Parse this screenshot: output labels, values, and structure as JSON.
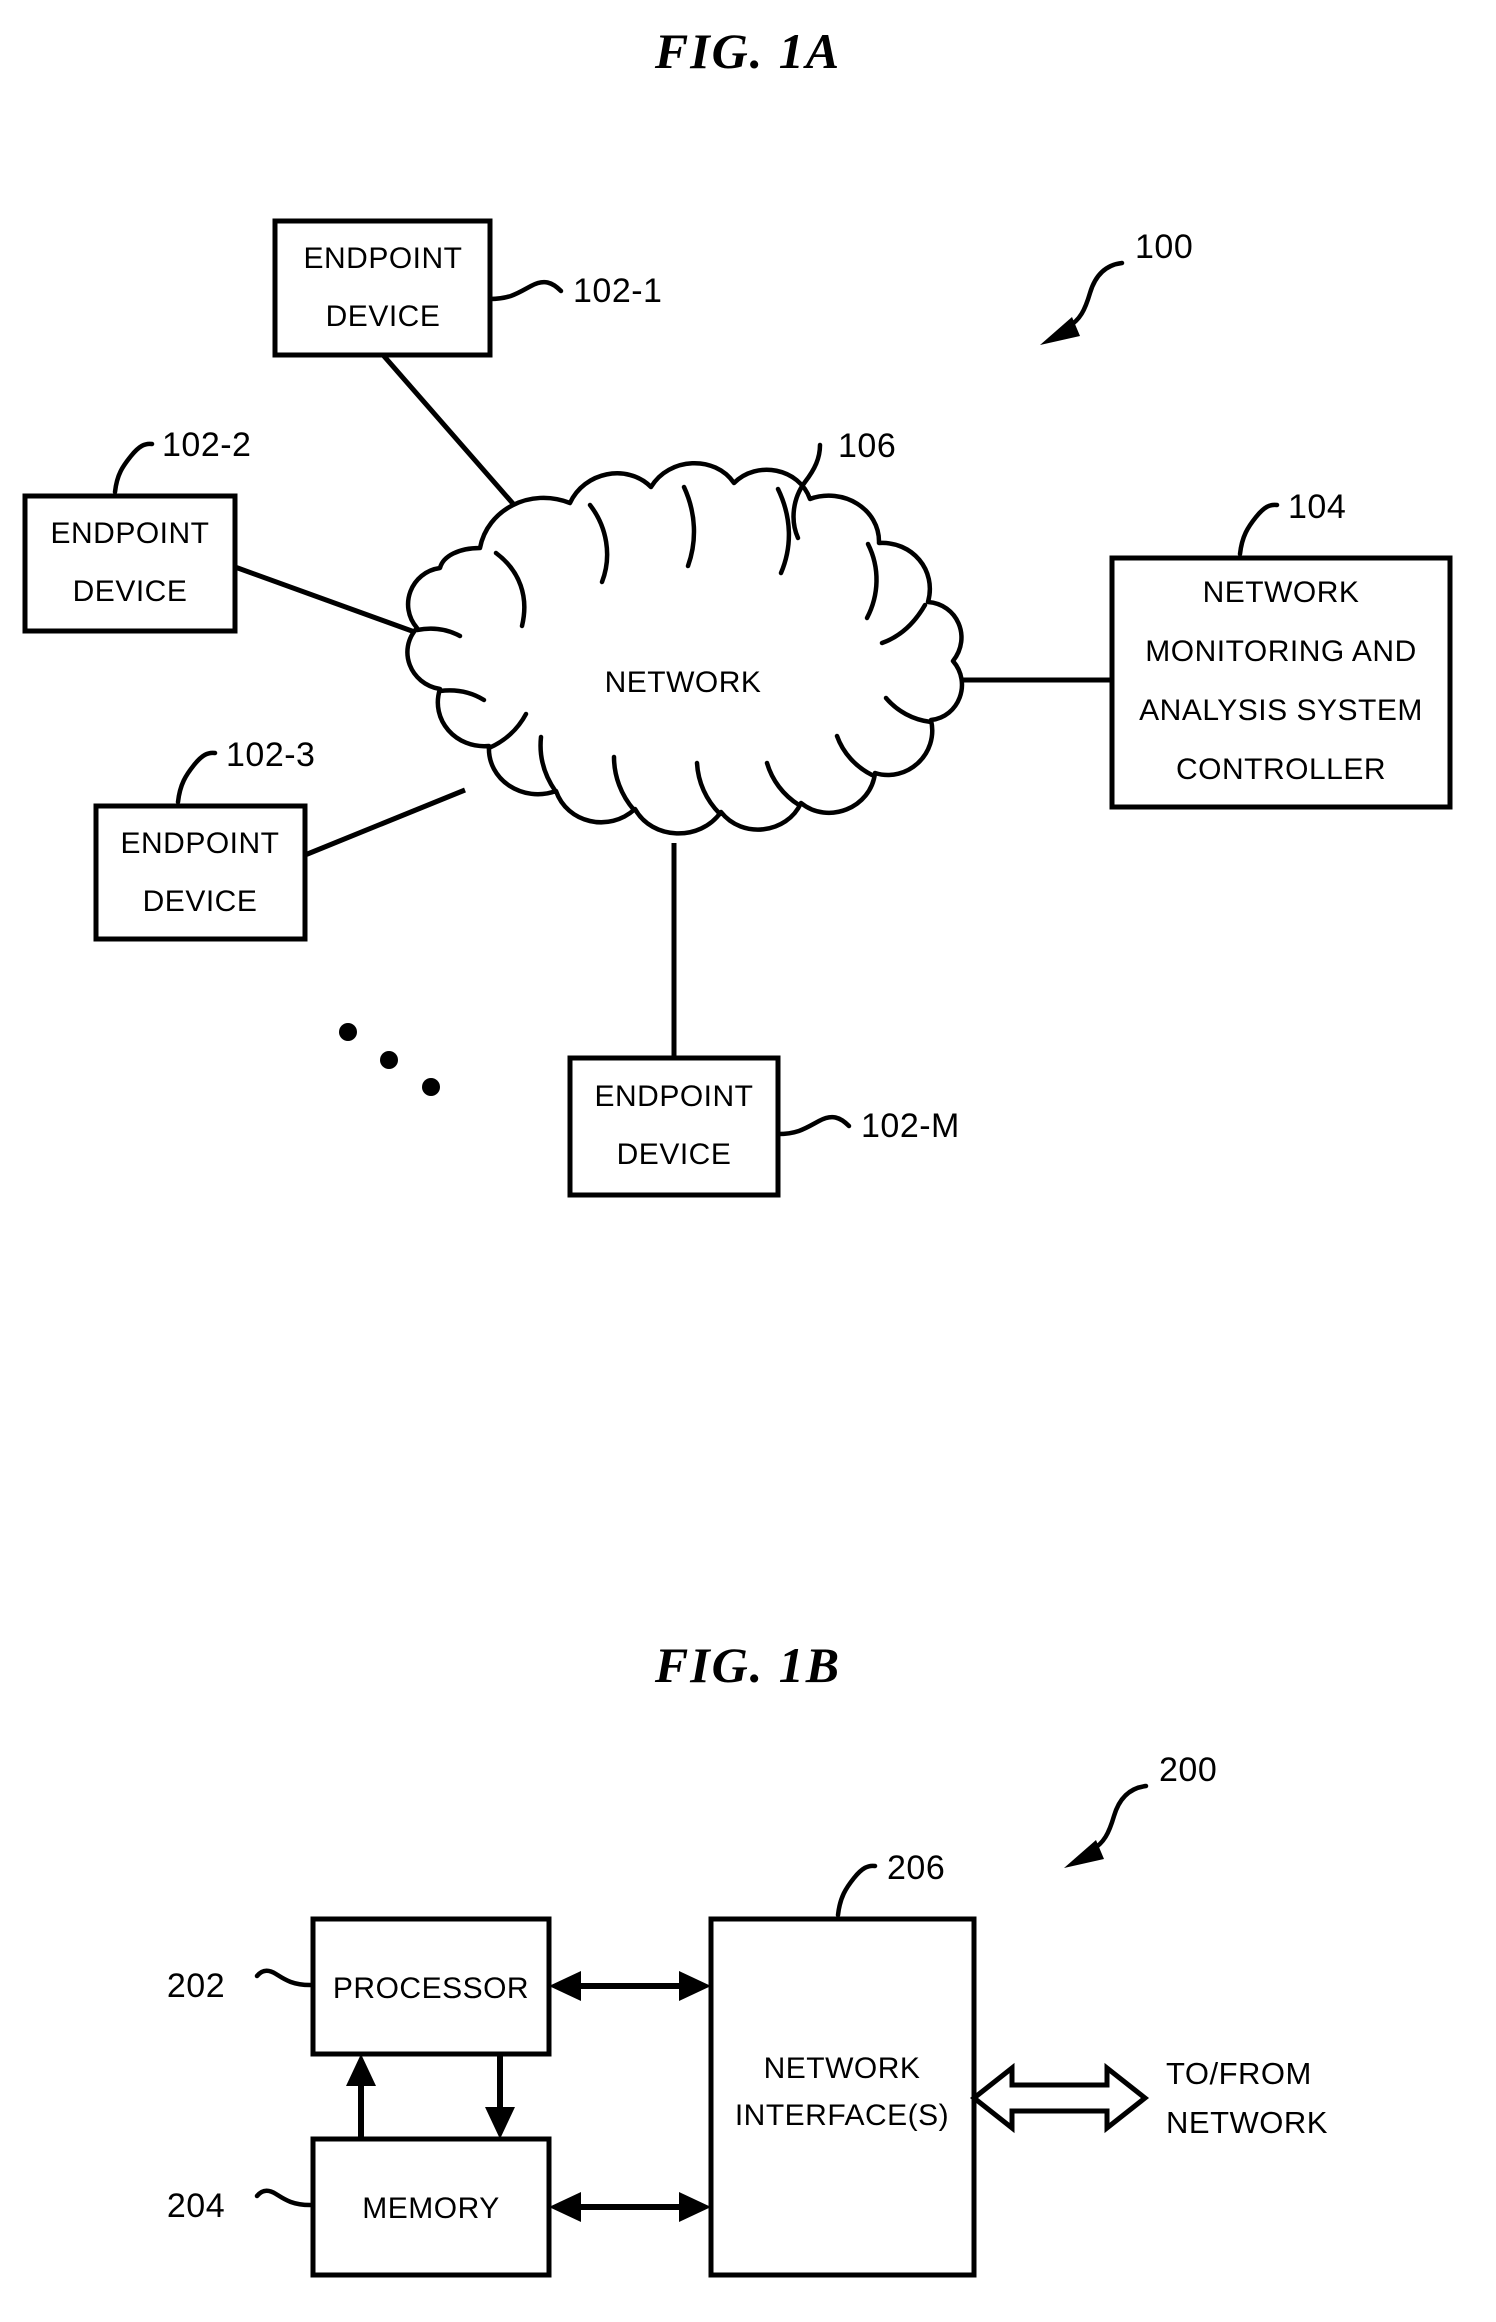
{
  "document": {
    "type": "patent-drawing-sheet",
    "background_color": "#ffffff",
    "ink_color": "#000000"
  },
  "figures": [
    {
      "id": "fig-1a",
      "title": "FIG.  1A",
      "system_reference": "100",
      "nodes": [
        {
          "id": "ep1",
          "label_line1": "ENDPOINT",
          "label_line2": "DEVICE",
          "reference": "102-1"
        },
        {
          "id": "ep2",
          "label_line1": "ENDPOINT",
          "label_line2": "DEVICE",
          "reference": "102-2"
        },
        {
          "id": "ep3",
          "label_line1": "ENDPOINT",
          "label_line2": "DEVICE",
          "reference": "102-3"
        },
        {
          "id": "epm",
          "label_line1": "ENDPOINT",
          "label_line2": "DEVICE",
          "reference": "102-M"
        }
      ],
      "cloud": {
        "label": "NETWORK",
        "reference": "106"
      },
      "controller": {
        "label_line1": "NETWORK",
        "label_line2": "MONITORING AND",
        "label_line3": "ANALYSIS SYSTEM",
        "label_line4": "CONTROLLER",
        "reference": "104"
      },
      "ellipsis": "..."
    },
    {
      "id": "fig-1b",
      "title": "FIG.  1B",
      "system_reference": "200",
      "blocks": [
        {
          "id": "processor",
          "label": "PROCESSOR",
          "reference": "202"
        },
        {
          "id": "memory",
          "label": "MEMORY",
          "reference": "204"
        },
        {
          "id": "network-interfaces",
          "label_line1": "NETWORK",
          "label_line2": "INTERFACE(S)",
          "reference": "206"
        }
      ],
      "external": {
        "label_line1": "TO/FROM",
        "label_line2": "NETWORK"
      }
    }
  ]
}
